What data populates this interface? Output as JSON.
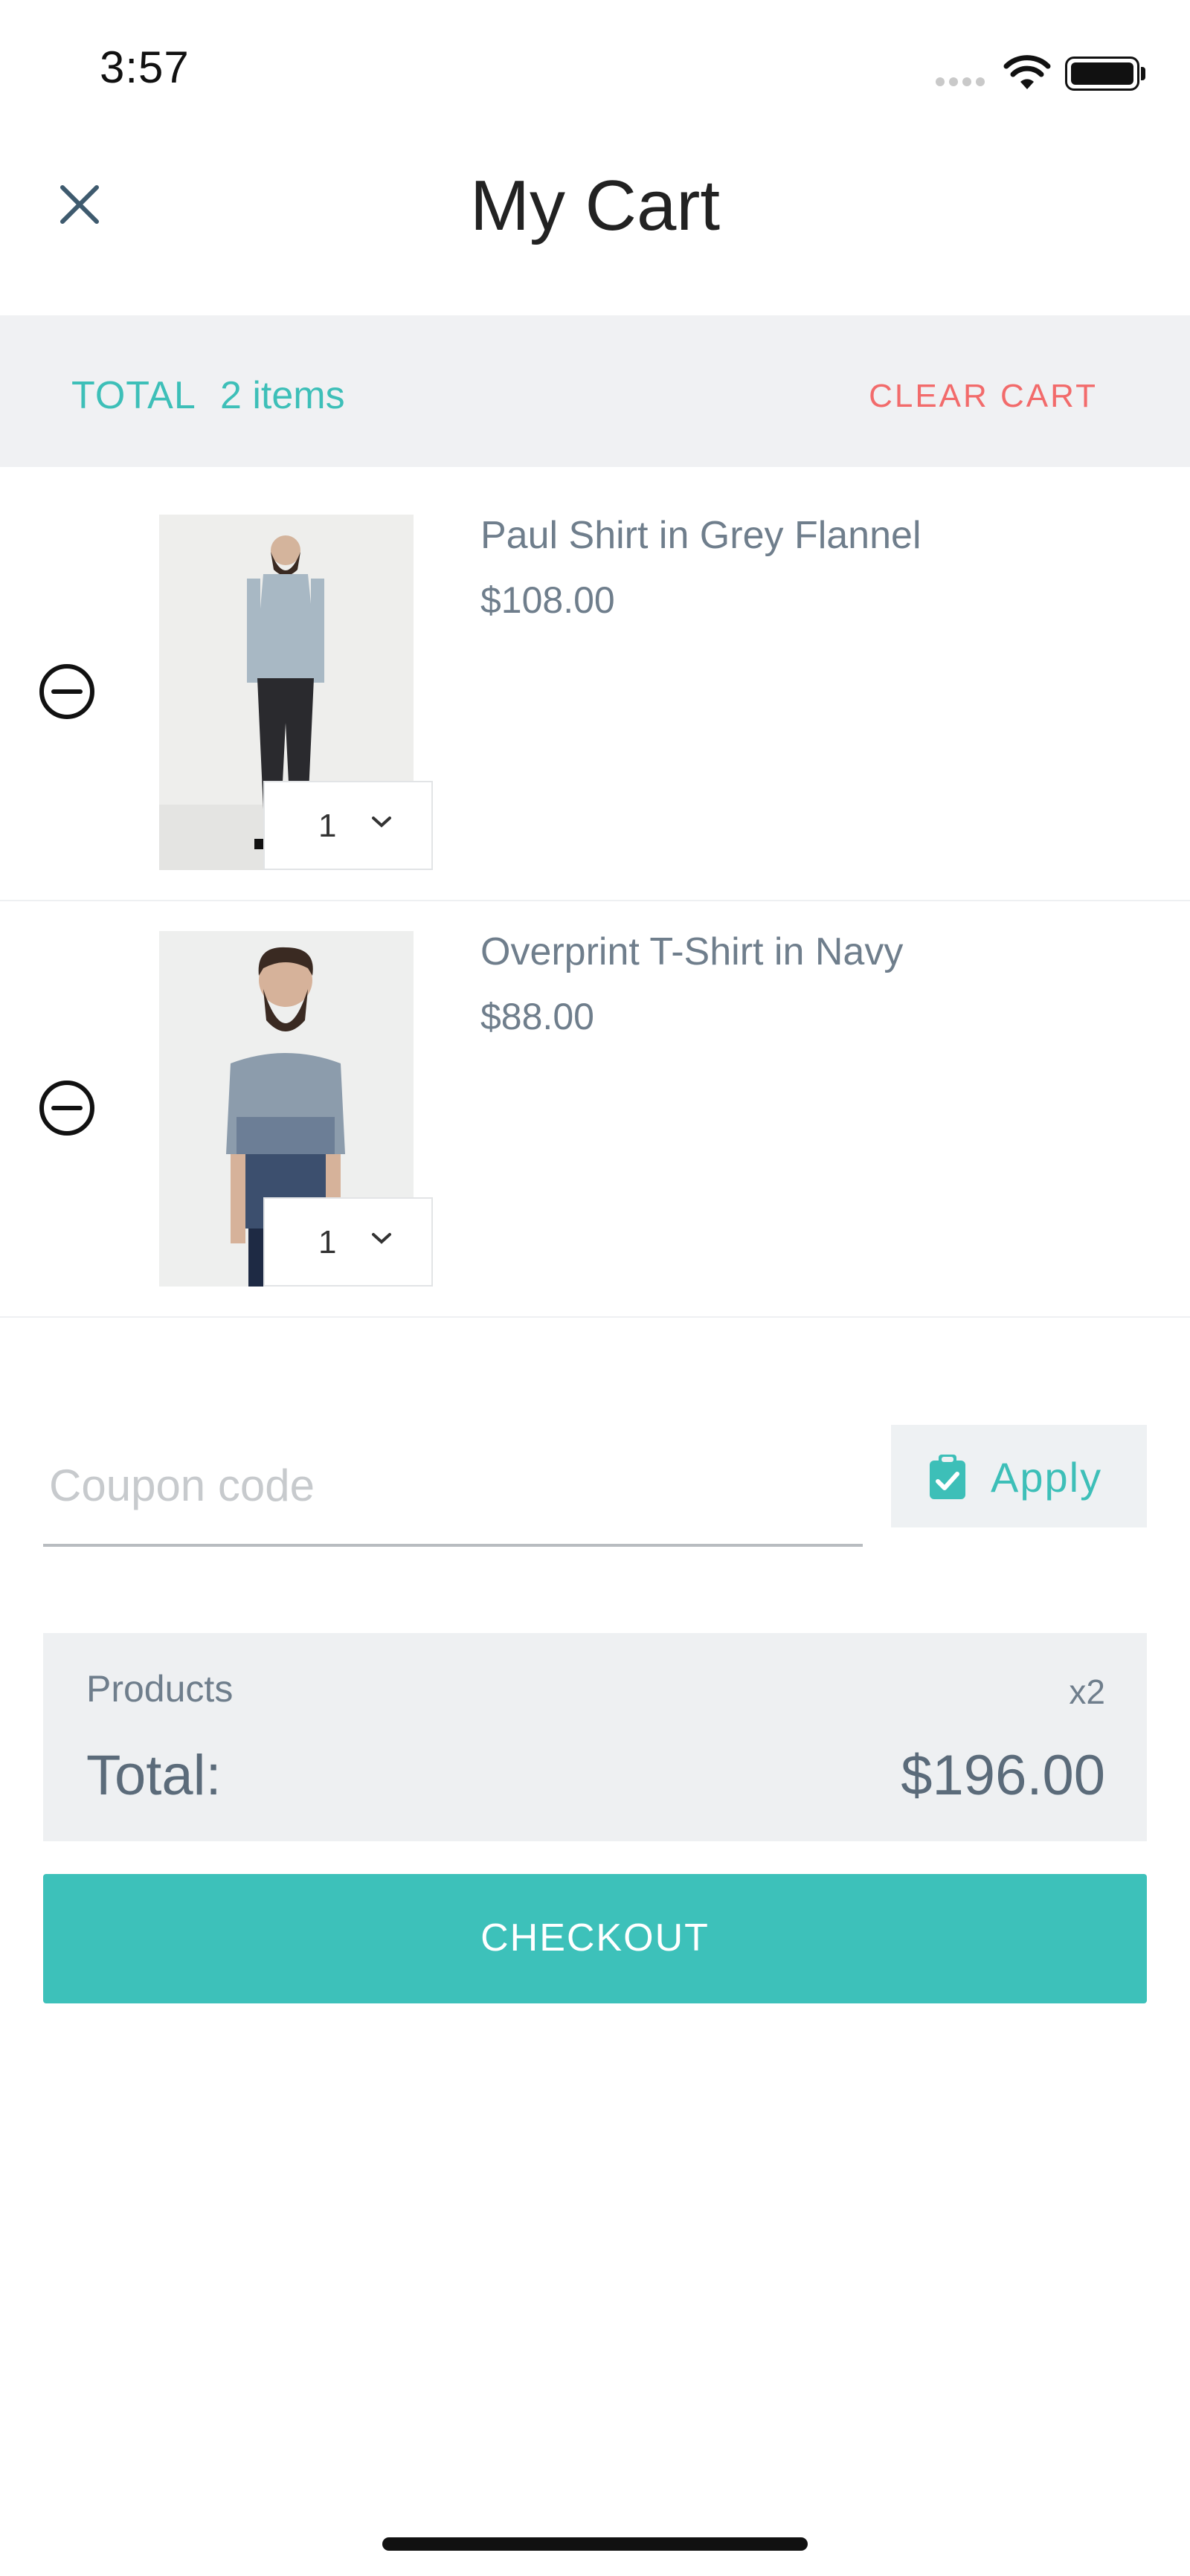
{
  "status_bar": {
    "time": "3:57"
  },
  "header": {
    "title": "My Cart"
  },
  "total_bar": {
    "label": "TOTAL",
    "count": "2 items",
    "clear_label": "CLEAR CART"
  },
  "items": [
    {
      "name": "Paul Shirt in Grey Flannel",
      "price": "$108.00",
      "quantity": "1"
    },
    {
      "name": "Overprint T-Shirt in Navy",
      "price": "$88.00",
      "quantity": "1"
    }
  ],
  "coupon": {
    "placeholder": "Coupon code",
    "apply_label": "Apply"
  },
  "summary": {
    "products_label": "Products",
    "products_count": "x2",
    "total_label": "Total:",
    "total_value": "$196.00"
  },
  "checkout": {
    "label": "CHECKOUT"
  },
  "colors": {
    "accent": "#3dc1ba",
    "danger": "#f26b6b",
    "panel": "#eef0f2"
  }
}
